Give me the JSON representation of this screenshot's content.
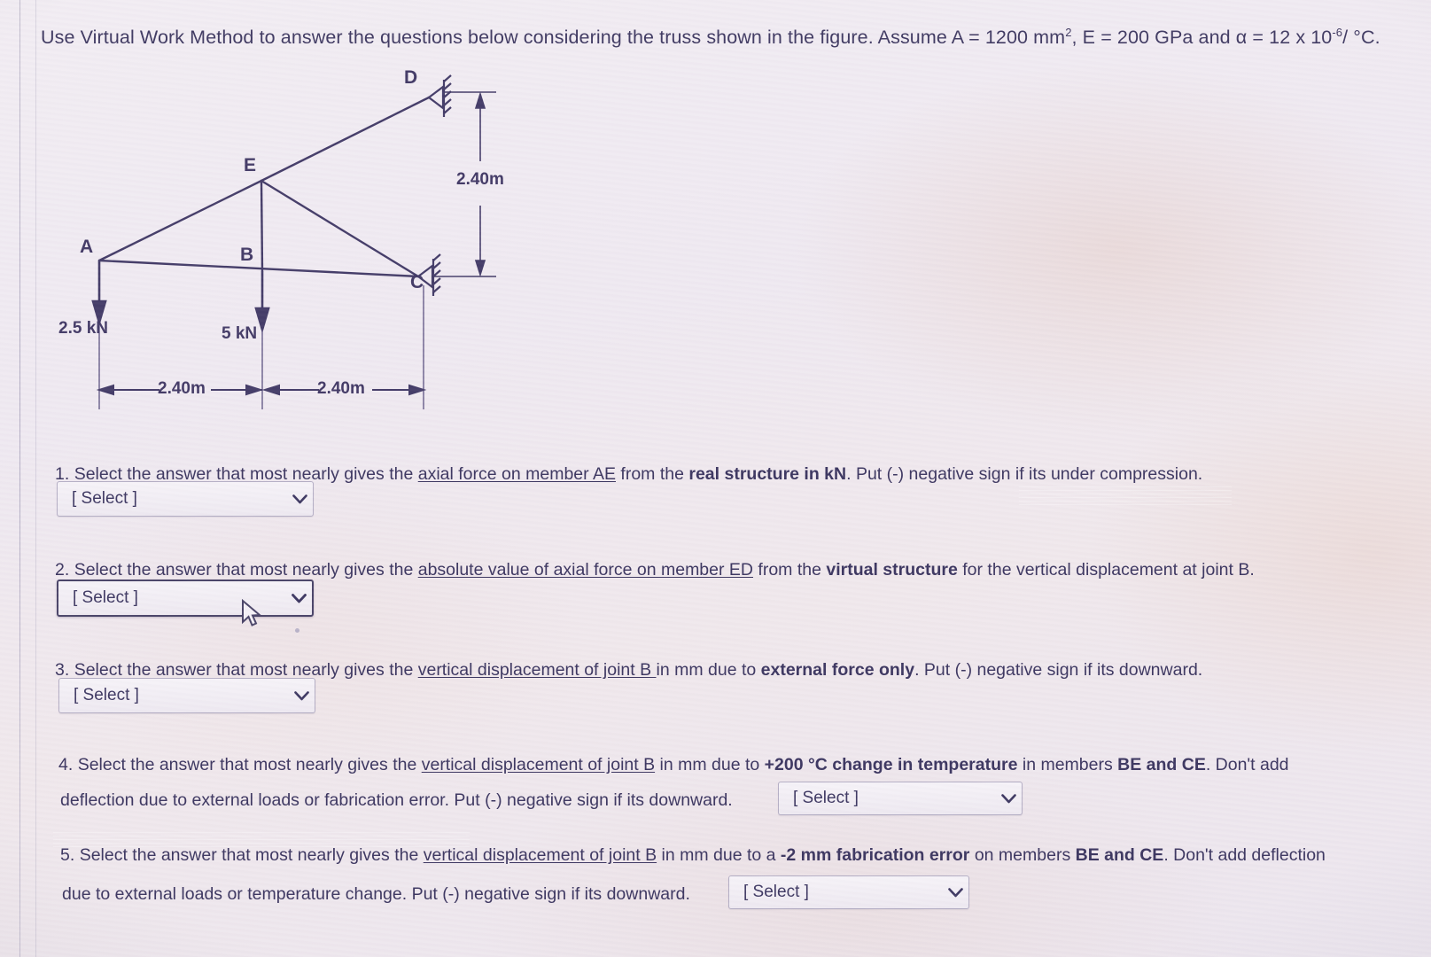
{
  "prompt": {
    "line": "Use Virtual Work Method to answer the questions below considering the truss shown in the figure.  Assume A = 1200 mm",
    "sup_area": "2",
    "mid": ", E = 200 GPa and α  = 12 x 10",
    "sup_exp": "-6",
    "tail": "/ °C."
  },
  "figure": {
    "joints": {
      "A": "A",
      "B": "B",
      "C": "C",
      "D": "D",
      "E": "E"
    },
    "loads": {
      "at_A": "2.5 kN",
      "at_B": "5 kN"
    },
    "dimensions": {
      "span_left": "2.40m",
      "span_right": "2.40m",
      "height": "2.40m"
    },
    "supports": [
      "pin-support-at-D",
      "pin-support-at-C"
    ]
  },
  "questions": [
    {
      "number": "1.",
      "parts": [
        {
          "t": "Select the answer that most nearly gives the ",
          "s": "plain"
        },
        {
          "t": "axial force on member AE",
          "s": "underline"
        },
        {
          "t": " from the ",
          "s": "plain"
        },
        {
          "t": "real structure in kN",
          "s": "bold"
        },
        {
          "t": ". Put (-) negative sign if its under compression.",
          "s": "plain"
        }
      ],
      "select": {
        "value": "[ Select ]",
        "focused": false
      }
    },
    {
      "number": "2.",
      "parts": [
        {
          "t": "Select the answer that most nearly gives the ",
          "s": "plain"
        },
        {
          "t": "absolute value of axial force on member ED",
          "s": "underline"
        },
        {
          "t": " from the ",
          "s": "plain"
        },
        {
          "t": "virtual structure",
          "s": "bold"
        },
        {
          "t": " for the vertical displacement at joint B.",
          "s": "plain"
        }
      ],
      "select": {
        "value": "[ Select ]",
        "focused": true
      }
    },
    {
      "number": "3.",
      "parts": [
        {
          "t": "Select the answer that most nearly gives the ",
          "s": "plain"
        },
        {
          "t": "vertical displacement of joint B ",
          "s": "underline"
        },
        {
          "t": "in mm due to ",
          "s": "plain"
        },
        {
          "t": "external force only",
          "s": "bold"
        },
        {
          "t": ". Put (-) negative sign if its downward.",
          "s": "plain"
        }
      ],
      "select": {
        "value": "[ Select ]",
        "focused": false
      }
    },
    {
      "number": "4.",
      "parts": [
        {
          "t": "Select the answer that most nearly gives the ",
          "s": "plain"
        },
        {
          "t": "vertical displacement of joint B",
          "s": "underline"
        },
        {
          "t": " in mm due to ",
          "s": "plain"
        },
        {
          "t": "+200 °C change in temperature",
          "s": "bold"
        },
        {
          "t": " in members ",
          "s": "plain"
        },
        {
          "t": "BE and CE",
          "s": "bold"
        },
        {
          "t": ". Don't add",
          "s": "plain"
        }
      ],
      "line2": [
        {
          "t": "deflection due to external loads or fabrication error. Put (-) negative sign if its downward.",
          "s": "plain"
        }
      ],
      "select": {
        "value": "[ Select ]",
        "focused": false
      }
    },
    {
      "number": "5.",
      "parts": [
        {
          "t": "Select the answer that most nearly gives the ",
          "s": "plain"
        },
        {
          "t": "vertical displacement of joint B",
          "s": "underline"
        },
        {
          "t": " in mm due to a ",
          "s": "plain"
        },
        {
          "t": "-2 mm fabrication error",
          "s": "bold"
        },
        {
          "t": " on members ",
          "s": "plain"
        },
        {
          "t": "BE and CE",
          "s": "bold"
        },
        {
          "t": ". Don't add deflection",
          "s": "plain"
        }
      ],
      "line2": [
        {
          "t": "due to external loads or temperature change. Put (-) negative sign if its downward.",
          "s": "plain"
        }
      ],
      "select": {
        "value": "[ Select ]",
        "focused": false
      }
    }
  ],
  "colors": {
    "ink": "#3b3560",
    "paper": "#efeaf0",
    "select_border": "#b4aec4",
    "select_border_focused": "#4a4468"
  }
}
